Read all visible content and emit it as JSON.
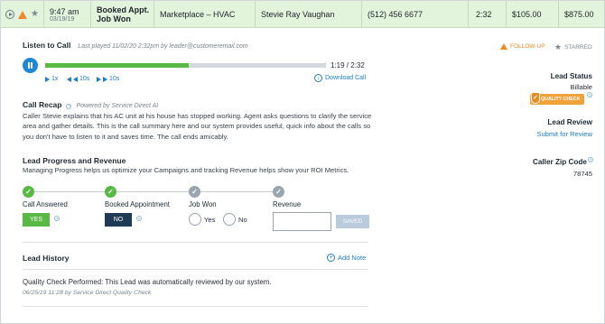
{
  "top_row": {
    "time": "9:47 am",
    "date": "03/19/19",
    "status_line1": "Booked Appt.",
    "status_line2": "Job Won",
    "campaign": "Marketplace – HVAC",
    "caller_name": "Stevie Ray Vaughan",
    "phone": "(512) 456 6677",
    "duration": "2:32",
    "revenue": "$105.00",
    "value": "$875.00",
    "icons": [
      "play-icon",
      "warning-icon",
      "star-icon"
    ],
    "row_color": "#e2f4dc"
  },
  "listen": {
    "title": "Listen to Call",
    "last_played": "Last played 11/02/20 2:32pm by leader@customeremail.com",
    "progress_fraction": 0.51,
    "time_display": "1:19 / 2:32",
    "speed": "1x",
    "rewind": "10s",
    "forward": "10s",
    "download": "Download Call"
  },
  "recap": {
    "title": "Call Recap",
    "powered": "Powered by Service Direct AI",
    "text": "Caller Stevie explains that his AC unit at his house has stopped working. Agent asks questions to clarify the service area and gather details. This is the call summary here and our system provides useful, quick info about the calls so you don't have to listen to it and saves time. The call ends amicably."
  },
  "progress": {
    "title": "Lead Progress and Revenue",
    "text": "Managing Progress helps us optimize your Campaigns and tracking Revenue helps show your ROI Metrics.",
    "steps": [
      {
        "label": "Call Answered",
        "complete": true
      },
      {
        "label": "Booked Appointment",
        "complete": true
      },
      {
        "label": "Job Won",
        "complete": false
      },
      {
        "label": "Revenue",
        "complete": false
      }
    ],
    "yes_label": "YES",
    "no_label": "NO",
    "radio_yes": "Yes",
    "radio_no": "No",
    "revenue_value": "",
    "saved_label": "SAVED"
  },
  "history": {
    "title": "Lead History",
    "add_note": "Add Note",
    "entry_text": "Quality Check Performed: This Lead was automatically reviewed by our system.",
    "entry_meta": "06/25/19 11:28 by Service Direct Quality Check"
  },
  "side": {
    "follow_up": "FOLLOW-UP",
    "starred": "STARRED",
    "lead_status_title": "Lead Status",
    "lead_status_value": "Billable",
    "quality_badge": "QUALITY CHECK",
    "lead_review_title": "Lead Review",
    "lead_review_link": "Submit for Review",
    "zip_title": "Caller Zip Code",
    "zip_value": "78745"
  },
  "colors": {
    "accent_green": "#58b945",
    "link_blue": "#1e7dc8",
    "warning_orange": "#ef8a2c",
    "navy": "#1e3a55"
  }
}
